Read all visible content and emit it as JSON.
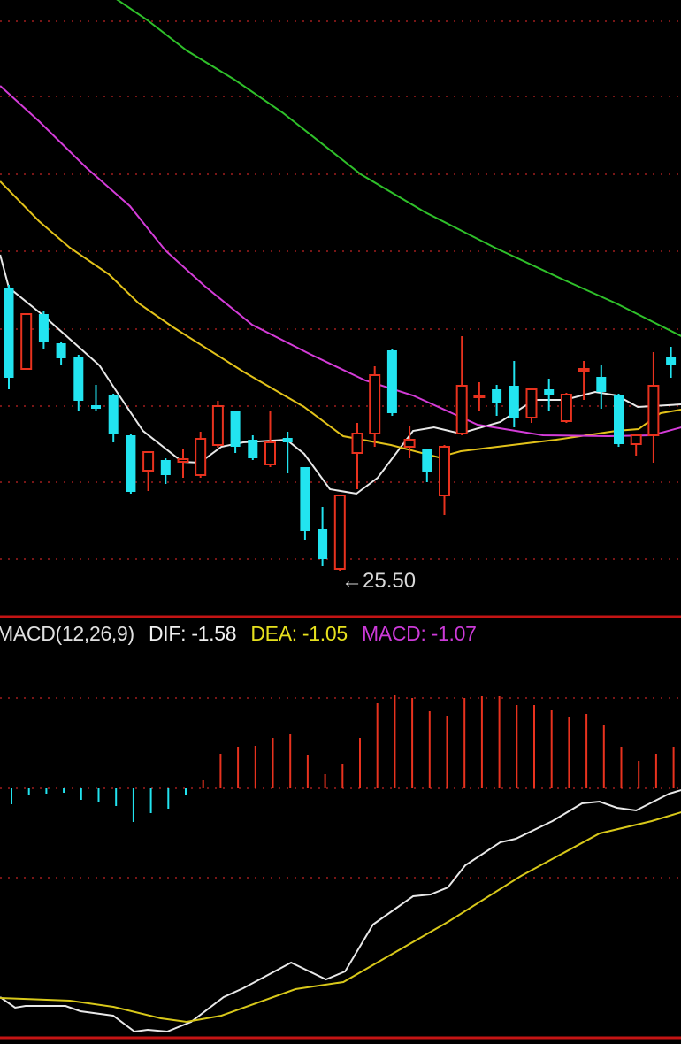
{
  "chart_data": [
    {
      "type": "candlestick",
      "title": "",
      "ylim": [
        25.05,
        31.95
      ],
      "grid": true,
      "colors": {
        "up": "#e8321e",
        "down": "#22e4f0",
        "ma5": "#e8e8e8",
        "ma10": "#e2c21a",
        "ma20": "#d43cd8",
        "ma60": "#2fc02a",
        "grid": "#a01e1e",
        "separator": "#c41414"
      },
      "annotation": {
        "label": "25.50",
        "arrow": "←",
        "price": 25.5,
        "index": 19
      },
      "candles": [
        {
          "o": 28.7,
          "c": 27.68,
          "h": 28.73,
          "l": 27.55
        },
        {
          "o": 27.78,
          "c": 28.4,
          "h": 28.4,
          "l": 27.78
        },
        {
          "o": 28.4,
          "c": 28.08,
          "h": 28.43,
          "l": 28.0
        },
        {
          "o": 28.07,
          "c": 27.9,
          "h": 28.09,
          "l": 27.83
        },
        {
          "o": 27.92,
          "c": 27.42,
          "h": 27.94,
          "l": 27.3
        },
        {
          "o": 27.37,
          "c": 27.33,
          "h": 27.6,
          "l": 27.3
        },
        {
          "o": 27.48,
          "c": 27.05,
          "h": 27.5,
          "l": 26.95
        },
        {
          "o": 27.03,
          "c": 26.39,
          "h": 27.05,
          "l": 26.37
        },
        {
          "o": 26.63,
          "c": 26.84,
          "h": 26.85,
          "l": 26.4
        },
        {
          "o": 26.75,
          "c": 26.58,
          "h": 26.77,
          "l": 26.48
        },
        {
          "o": 26.73,
          "c": 26.76,
          "h": 26.87,
          "l": 26.55
        },
        {
          "o": 26.58,
          "c": 26.99,
          "h": 27.07,
          "l": 26.55
        },
        {
          "o": 26.92,
          "c": 27.36,
          "h": 27.42,
          "l": 26.89
        },
        {
          "o": 27.3,
          "c": 26.9,
          "h": 27.3,
          "l": 26.83
        },
        {
          "o": 26.98,
          "c": 26.77,
          "h": 27.03,
          "l": 26.75
        },
        {
          "o": 26.7,
          "c": 26.95,
          "h": 27.3,
          "l": 26.67
        },
        {
          "o": 27.0,
          "c": 26.95,
          "h": 27.07,
          "l": 26.6
        },
        {
          "o": 26.67,
          "c": 25.95,
          "h": 26.67,
          "l": 25.85
        },
        {
          "o": 25.97,
          "c": 25.63,
          "h": 26.22,
          "l": 25.55
        },
        {
          "o": 25.52,
          "c": 26.35,
          "h": 26.35,
          "l": 25.5
        },
        {
          "o": 26.83,
          "c": 27.05,
          "h": 27.17,
          "l": 26.42
        },
        {
          "o": 27.05,
          "c": 27.71,
          "h": 27.81,
          "l": 26.9
        },
        {
          "o": 27.99,
          "c": 27.28,
          "h": 28.0,
          "l": 27.25
        },
        {
          "o": 26.9,
          "c": 26.98,
          "h": 27.13,
          "l": 26.77
        },
        {
          "o": 26.87,
          "c": 26.62,
          "h": 26.87,
          "l": 26.5
        },
        {
          "o": 26.35,
          "c": 26.9,
          "h": 26.92,
          "l": 26.13
        },
        {
          "o": 27.05,
          "c": 27.59,
          "h": 28.15,
          "l": 27.03
        },
        {
          "o": 27.46,
          "c": 27.48,
          "h": 27.63,
          "l": 27.3
        },
        {
          "o": 27.55,
          "c": 27.4,
          "h": 27.6,
          "l": 27.25
        },
        {
          "o": 27.59,
          "c": 27.23,
          "h": 27.87,
          "l": 27.12
        },
        {
          "o": 27.23,
          "c": 27.55,
          "h": 27.57,
          "l": 27.17
        },
        {
          "o": 27.55,
          "c": 27.49,
          "h": 27.67,
          "l": 27.3
        },
        {
          "o": 27.19,
          "c": 27.49,
          "h": 27.51,
          "l": 27.17
        },
        {
          "o": 27.76,
          "c": 27.78,
          "h": 27.87,
          "l": 27.43
        },
        {
          "o": 27.69,
          "c": 27.52,
          "h": 27.82,
          "l": 27.33
        },
        {
          "o": 27.48,
          "c": 26.93,
          "h": 27.5,
          "l": 26.9
        },
        {
          "o": 26.93,
          "c": 27.03,
          "h": 27.05,
          "l": 26.8
        },
        {
          "o": 27.03,
          "c": 27.59,
          "h": 27.97,
          "l": 26.72
        },
        {
          "o": 27.92,
          "c": 27.82,
          "h": 28.03,
          "l": 27.68
        }
      ],
      "moving_averages": [
        {
          "name": "MA5",
          "color_key": "ma5",
          "points": [
            [
              -0.5,
              29.07
            ],
            [
              0,
              28.7
            ],
            [
              2,
              28.38
            ],
            [
              5.2,
              27.82
            ],
            [
              6.2,
              27.52
            ],
            [
              7.7,
              27.08
            ],
            [
              9.95,
              26.73
            ],
            [
              10.96,
              26.72
            ],
            [
              12.2,
              26.9
            ],
            [
              13.45,
              26.95
            ],
            [
              15.94,
              26.98
            ],
            [
              16.95,
              26.82
            ],
            [
              18.43,
              26.42
            ],
            [
              19.95,
              26.37
            ],
            [
              21.17,
              26.55
            ],
            [
              23.2,
              27.08
            ],
            [
              24.4,
              27.12
            ],
            [
              25.9,
              27.05
            ],
            [
              28.2,
              27.18
            ],
            [
              30.15,
              27.43
            ],
            [
              31.9,
              27.43
            ],
            [
              33.65,
              27.52
            ],
            [
              34.9,
              27.48
            ],
            [
              36.1,
              27.35
            ],
            [
              38.6,
              27.38
            ]
          ]
        },
        {
          "name": "MA10",
          "color_key": "ma10",
          "points": [
            [
              -0.5,
              29.9
            ],
            [
              1.73,
              29.45
            ],
            [
              3.5,
              29.15
            ],
            [
              5.74,
              28.85
            ],
            [
              7.46,
              28.52
            ],
            [
              9.44,
              28.25
            ],
            [
              13.45,
              27.75
            ],
            [
              16.95,
              27.35
            ],
            [
              19.19,
              27.02
            ],
            [
              21.93,
              26.92
            ],
            [
              24.67,
              26.78
            ],
            [
              25.94,
              26.85
            ],
            [
              31.42,
              26.98
            ],
            [
              34.87,
              27.08
            ],
            [
              36.14,
              27.1
            ],
            [
              37.41,
              27.28
            ],
            [
              38.6,
              27.32
            ]
          ]
        },
        {
          "name": "MA20",
          "color_key": "ma20",
          "points": [
            [
              -0.5,
              30.98
            ],
            [
              1.73,
              30.58
            ],
            [
              4.47,
              30.05
            ],
            [
              6.95,
              29.62
            ],
            [
              8.98,
              29.12
            ],
            [
              11.22,
              28.72
            ],
            [
              13.96,
              28.28
            ],
            [
              17.26,
              27.95
            ],
            [
              20.46,
              27.65
            ],
            [
              23.2,
              27.48
            ],
            [
              26.9,
              27.15
            ],
            [
              30.66,
              27.03
            ],
            [
              34.42,
              27.02
            ],
            [
              36.9,
              27.03
            ],
            [
              38.6,
              27.12
            ]
          ]
        },
        {
          "name": "MA60",
          "color_key": "ma60",
          "points": [
            [
              6.1,
              31.97
            ],
            [
              7.97,
              31.72
            ],
            [
              10.2,
              31.38
            ],
            [
              12.95,
              31.05
            ],
            [
              15.69,
              30.68
            ],
            [
              20.2,
              29.98
            ],
            [
              23.9,
              29.55
            ],
            [
              27.9,
              29.15
            ],
            [
              31.93,
              28.78
            ],
            [
              34.87,
              28.52
            ],
            [
              38.6,
              28.15
            ]
          ]
        }
      ]
    },
    {
      "type": "bar+line",
      "title": "MACD(12,26,9)",
      "ylim": [
        -2.82,
        1.94
      ],
      "legend": [
        {
          "label": "MACD(12,26,9)",
          "color": "#e0e0e0"
        },
        {
          "label": "DIF: -1.58",
          "color": "#f0f0f0"
        },
        {
          "label": "DEA: -1.05",
          "color": "#e6e01e"
        },
        {
          "label": "MACD: -1.07",
          "color": "#cc3ad8"
        }
      ],
      "histogram": [
        -0.18,
        -0.08,
        -0.06,
        -0.05,
        -0.13,
        -0.16,
        -0.2,
        -0.38,
        -0.28,
        -0.23,
        -0.08,
        0.09,
        0.39,
        0.47,
        0.48,
        0.57,
        0.61,
        0.38,
        0.16,
        0.27,
        0.57,
        0.96,
        1.06,
        1.02,
        0.87,
        0.82,
        1.02,
        1.04,
        1.04,
        0.94,
        0.94,
        0.89,
        0.81,
        0.84,
        0.71,
        0.47,
        0.31,
        0.39,
        0.47
      ],
      "series": [
        {
          "name": "DIF",
          "color": "#e8e8e8",
          "points": [
            [
              -0.5,
              -2.36
            ],
            [
              0.36,
              -2.48
            ],
            [
              0.96,
              -2.46
            ],
            [
              3.25,
              -2.46
            ],
            [
              4.11,
              -2.52
            ],
            [
              5.99,
              -2.57
            ],
            [
              7.21,
              -2.75
            ],
            [
              7.97,
              -2.73
            ],
            [
              9.09,
              -2.75
            ],
            [
              10.46,
              -2.64
            ],
            [
              12.33,
              -2.36
            ],
            [
              13.45,
              -2.26
            ],
            [
              16.2,
              -1.97
            ],
            [
              18.2,
              -2.16
            ],
            [
              19.3,
              -2.07
            ],
            [
              20.9,
              -1.54
            ],
            [
              23.2,
              -1.22
            ],
            [
              24.2,
              -1.2
            ],
            [
              25.2,
              -1.12
            ],
            [
              26.2,
              -0.87
            ],
            [
              28.2,
              -0.61
            ],
            [
              29.1,
              -0.57
            ],
            [
              31.2,
              -0.37
            ],
            [
              32.9,
              -0.17
            ],
            [
              33.9,
              -0.15
            ],
            [
              34.9,
              -0.22
            ],
            [
              36.0,
              -0.25
            ],
            [
              37.9,
              -0.06
            ],
            [
              38.6,
              -0.02
            ]
          ]
        },
        {
          "name": "DEA",
          "color": "#d8c81a",
          "points": [
            [
              -0.5,
              -2.37
            ],
            [
              3.5,
              -2.4
            ],
            [
              6.0,
              -2.47
            ],
            [
              8.73,
              -2.6
            ],
            [
              10.2,
              -2.64
            ],
            [
              12.2,
              -2.57
            ],
            [
              16.45,
              -2.27
            ],
            [
              19.2,
              -2.19
            ],
            [
              25.2,
              -1.51
            ],
            [
              29.4,
              -0.99
            ],
            [
              33.9,
              -0.51
            ],
            [
              36.9,
              -0.37
            ],
            [
              38.6,
              -0.27
            ]
          ]
        }
      ]
    }
  ]
}
